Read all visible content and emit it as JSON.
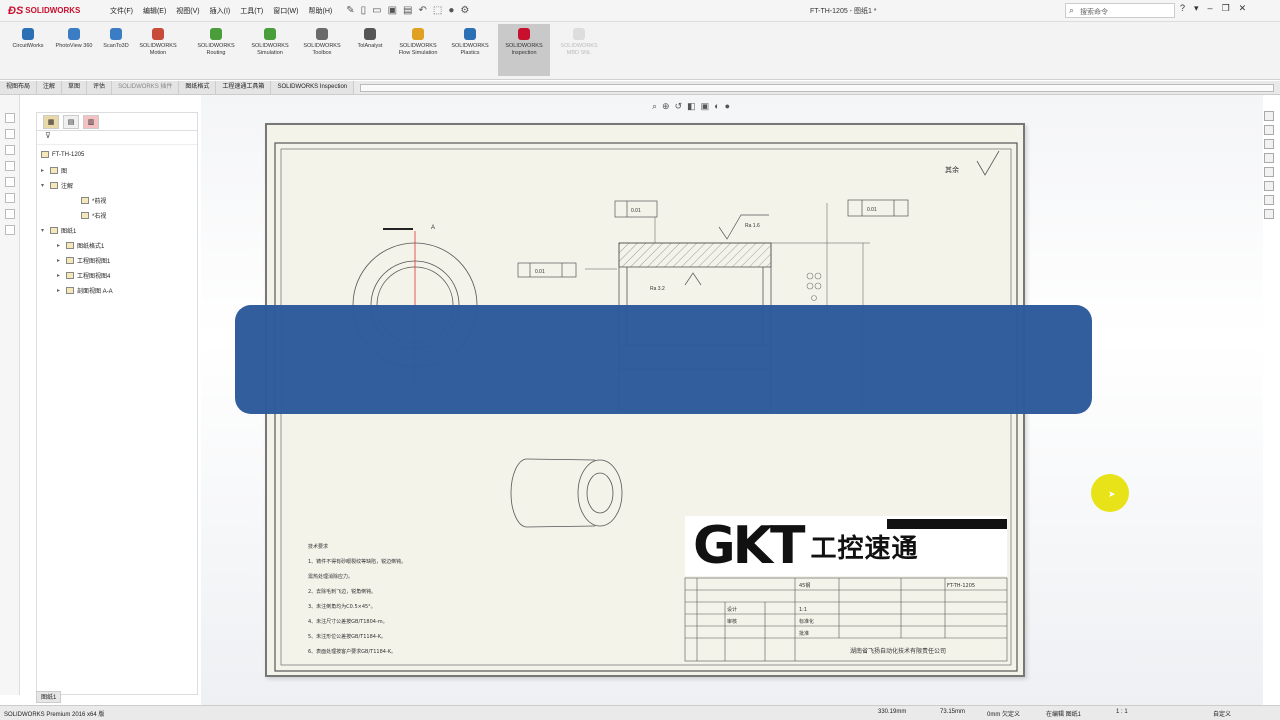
{
  "app": {
    "logo_text": "SOLIDWORKS",
    "document_title": "FT-TH-1205 - 图纸1 *",
    "menus": [
      "文件(F)",
      "编辑(E)",
      "视图(V)",
      "插入(I)",
      "工具(T)",
      "窗口(W)",
      "帮助(H)"
    ],
    "search_placeholder": "搜索命令"
  },
  "command_manager": [
    {
      "label": "CircuitWorks",
      "icon": "circuit-icon",
      "color": "#2b6fb5"
    },
    {
      "label": "PhotoView 360",
      "icon": "photoview-icon",
      "color": "#3a7dc4"
    },
    {
      "label": "ScanTo3D",
      "icon": "scan-icon",
      "color": "#3a7dc4"
    },
    {
      "label": "SOLIDWORKS Motion",
      "icon": "motion-icon",
      "color": "#c84b3a"
    },
    {
      "label": "SOLIDWORKS Routing",
      "icon": "routing-icon",
      "color": "#4a9d3b"
    },
    {
      "label": "SOLIDWORKS Simulation",
      "icon": "simulation-icon",
      "color": "#4a9d3b"
    },
    {
      "label": "SOLIDWORKS Toolbox",
      "icon": "toolbox-icon",
      "color": "#6a6a6a"
    },
    {
      "label": "TolAnalyst",
      "icon": "tolanalyst-icon",
      "color": "#555555"
    },
    {
      "label": "SOLIDWORKS Flow Simulation",
      "icon": "flow-icon",
      "color": "#e0a020"
    },
    {
      "label": "SOLIDWORKS Plastics",
      "icon": "plastics-icon",
      "color": "#2b6fb5"
    },
    {
      "label": "SOLIDWORKS Inspection",
      "icon": "inspection-icon",
      "color": "#c8102e"
    },
    {
      "label": "SOLIDWORKS MBD SNL",
      "icon": "mbd-icon",
      "color": "#bbbbbb"
    }
  ],
  "tabs": [
    "视图布局",
    "注解",
    "草图",
    "评估",
    "SOLIDWORKS 插件",
    "图纸格式",
    "工程速通工具箱",
    "SOLIDWORKS Inspection"
  ],
  "feature_tree": {
    "root": "FT-TH-1205",
    "items": [
      {
        "label": "图",
        "indent": 1,
        "toggle": "▸"
      },
      {
        "label": "注解",
        "indent": 1,
        "toggle": "▾"
      },
      {
        "label": "*前视",
        "indent": 3,
        "toggle": ""
      },
      {
        "label": "*右视",
        "indent": 3,
        "toggle": ""
      },
      {
        "label": "图纸1",
        "indent": 0,
        "toggle": "▾"
      },
      {
        "label": "图纸格式1",
        "indent": 1,
        "toggle": "▸"
      },
      {
        "label": "工程图视图1",
        "indent": 1,
        "toggle": "▸"
      },
      {
        "label": "工程图视图4",
        "indent": 1,
        "toggle": "▸"
      },
      {
        "label": "剖面视图 A-A",
        "indent": 1,
        "toggle": "▸"
      }
    ],
    "bottom_tab": "图纸1"
  },
  "drawing": {
    "surface_finish_label": "其余",
    "section_label": "A",
    "dim_ra_top": "Ra 1.6",
    "dim_ra_inner": "Ra 3.2",
    "gdt_left": "0.01",
    "gdt_top": "0.01",
    "gdt_right": "0.01",
    "tech_notes_title": "技术要求",
    "tech_notes": [
      "1、铸件不得有砂眼裂纹等缺陷，锐边倒钝。",
      "   需热处理消除应力。",
      "2、去除毛刺飞边，锐角倒钝。",
      "3、未注倒角均为C0.5×45°。",
      "4、未注尺寸公差按GB/T1804-m。",
      "5、未注形位公差按GB/T1184-K。",
      "6、表面处理按客户要求GB/T1184-K。"
    ],
    "title_block": {
      "company": "湖南省飞扬自动化技术有限责任公司",
      "part_no": "FT-TH-1205",
      "material": "45钢",
      "scale": "1:1",
      "design": "设计",
      "check": "审核",
      "approve": "批准",
      "standard": "标准化"
    }
  },
  "watermark": {
    "brand_latin": "GKT",
    "brand_cn": "工控速通"
  },
  "status": {
    "product": "SOLIDWORKS Premium 2016 x64 版",
    "x": "330.19mm",
    "y": "73.15mm",
    "z": "0mm 欠定义",
    "editing": "在编辑 图纸1",
    "scale": "1 : 1",
    "units": "自定义"
  }
}
